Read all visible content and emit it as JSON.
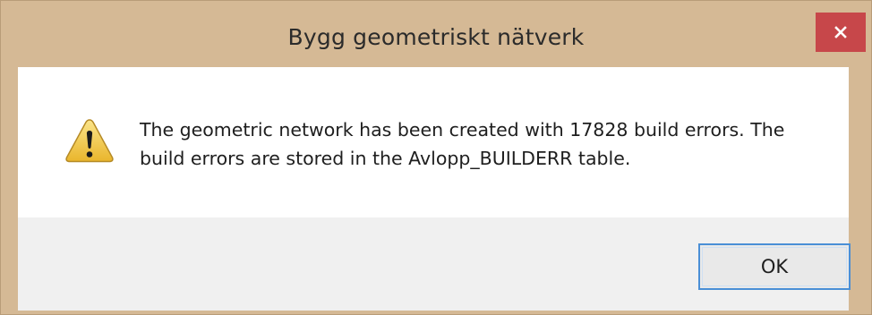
{
  "dialog": {
    "title": "Bygg geometriskt nätverk",
    "close_icon": "close-icon",
    "warning_icon": "warning-icon",
    "message_line1": "The geometric network has been created with 17828 build errors. The",
    "message_line2": "build errors are stored in the Avlopp_BUILDERR table.",
    "ok_label": "OK"
  },
  "colors": {
    "frame": "#d5b995",
    "close_button": "#c7474a",
    "button_focus_border": "#4a8fd6",
    "footer": "#f0f0f0"
  }
}
